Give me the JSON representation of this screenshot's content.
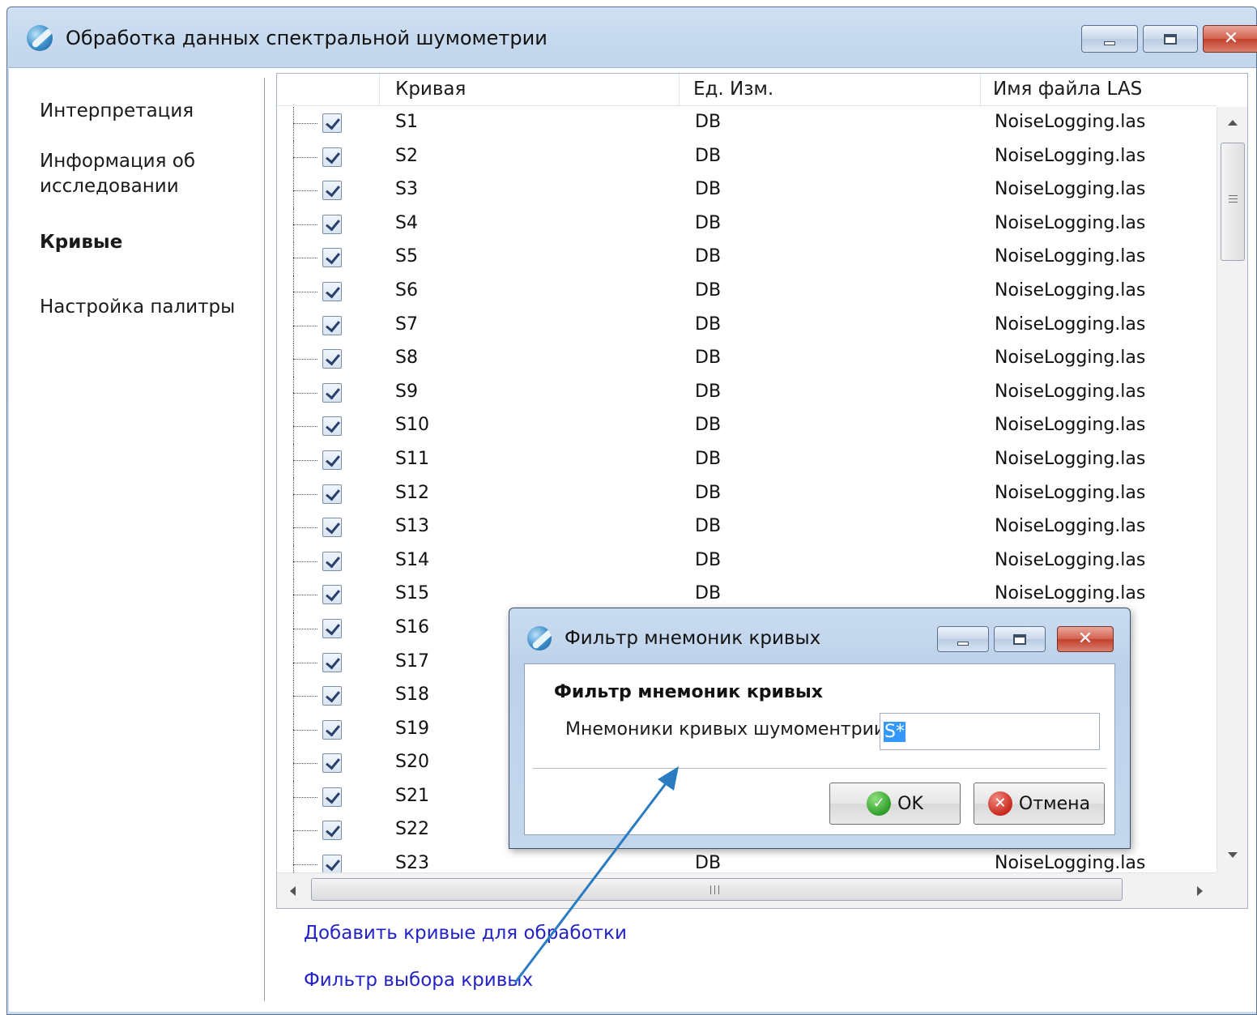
{
  "window": {
    "title": "Обработка данных спектральной шумометрии"
  },
  "nav": {
    "items": [
      {
        "label": "Интерпретация"
      },
      {
        "label": "Информация об",
        "label2": "исследовании"
      },
      {
        "label": "Кривые",
        "active": true
      },
      {
        "label": "Настройка палитры"
      }
    ]
  },
  "grid": {
    "columns": [
      "Кривая",
      "Ед. Изм.",
      "Имя файла LAS"
    ],
    "rows": [
      {
        "curve": "S1",
        "unit": "DB",
        "file": "NoiseLogging.las",
        "checked": true
      },
      {
        "curve": "S2",
        "unit": "DB",
        "file": "NoiseLogging.las",
        "checked": true
      },
      {
        "curve": "S3",
        "unit": "DB",
        "file": "NoiseLogging.las",
        "checked": true
      },
      {
        "curve": "S4",
        "unit": "DB",
        "file": "NoiseLogging.las",
        "checked": true
      },
      {
        "curve": "S5",
        "unit": "DB",
        "file": "NoiseLogging.las",
        "checked": true
      },
      {
        "curve": "S6",
        "unit": "DB",
        "file": "NoiseLogging.las",
        "checked": true
      },
      {
        "curve": "S7",
        "unit": "DB",
        "file": "NoiseLogging.las",
        "checked": true
      },
      {
        "curve": "S8",
        "unit": "DB",
        "file": "NoiseLogging.las",
        "checked": true
      },
      {
        "curve": "S9",
        "unit": "DB",
        "file": "NoiseLogging.las",
        "checked": true
      },
      {
        "curve": "S10",
        "unit": "DB",
        "file": "NoiseLogging.las",
        "checked": true
      },
      {
        "curve": "S11",
        "unit": "DB",
        "file": "NoiseLogging.las",
        "checked": true
      },
      {
        "curve": "S12",
        "unit": "DB",
        "file": "NoiseLogging.las",
        "checked": true
      },
      {
        "curve": "S13",
        "unit": "DB",
        "file": "NoiseLogging.las",
        "checked": true
      },
      {
        "curve": "S14",
        "unit": "DB",
        "file": "NoiseLogging.las",
        "checked": true
      },
      {
        "curve": "S15",
        "unit": "DB",
        "file": "NoiseLogging.las",
        "checked": true
      },
      {
        "curve": "S16",
        "unit": "",
        "file": "",
        "checked": true
      },
      {
        "curve": "S17",
        "unit": "",
        "file": "",
        "checked": true
      },
      {
        "curve": "S18",
        "unit": "",
        "file": "",
        "checked": true
      },
      {
        "curve": "S19",
        "unit": "",
        "file": "",
        "checked": true
      },
      {
        "curve": "S20",
        "unit": "",
        "file": "",
        "checked": true
      },
      {
        "curve": "S21",
        "unit": "",
        "file": "",
        "checked": true
      },
      {
        "curve": "S22",
        "unit": "",
        "file": "",
        "checked": true
      },
      {
        "curve": "S23",
        "unit": "DB",
        "file": "NoiseLogging.las",
        "checked": true
      }
    ],
    "hscroll_grip": "III",
    "vscroll_grip": "≡"
  },
  "links": {
    "add_curves": "Добавить кривые для обработки",
    "filter": "Фильтр выбора кривых"
  },
  "dialog": {
    "title": "Фильтр мнемоник кривых",
    "heading": "Фильтр мнемоник кривых",
    "field_label": "Мнемоники кривых шумоментрии",
    "field_value": "S*",
    "ok_label": "OK",
    "cancel_label": "Отмена"
  },
  "colors": {
    "link": "#2323c7",
    "annotation_arrow": "#2a7bc0",
    "selection": "#3399ff"
  }
}
